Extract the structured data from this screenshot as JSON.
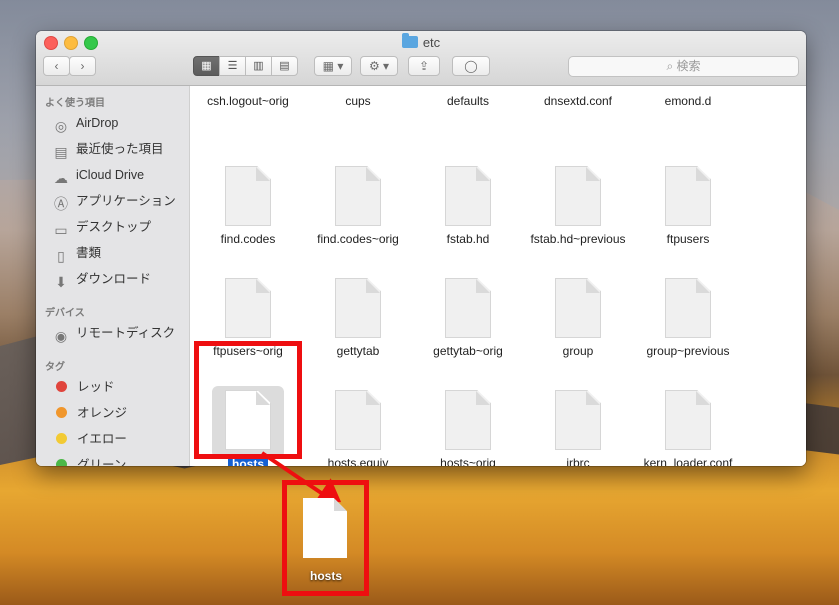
{
  "window": {
    "title": "etc",
    "search_placeholder": "検索"
  },
  "toolbar": {
    "back": "‹",
    "forward": "›",
    "views": [
      "▦",
      "☰",
      "▥",
      "▤"
    ],
    "arrange": "▦ ▾",
    "action": "⚙ ▾",
    "share": "⇪",
    "tag": "◯"
  },
  "sidebar": {
    "favorites_header": "よく使う項目",
    "favorites": [
      {
        "label": "AirDrop",
        "icon": "airdrop-icon"
      },
      {
        "label": "最近使った項目",
        "icon": "recents-icon"
      },
      {
        "label": "iCloud Drive",
        "icon": "cloud-icon"
      },
      {
        "label": "アプリケーション",
        "icon": "applications-icon"
      },
      {
        "label": "デスクトップ",
        "icon": "desktop-icon"
      },
      {
        "label": "書類",
        "icon": "documents-icon"
      },
      {
        "label": "ダウンロード",
        "icon": "downloads-icon"
      }
    ],
    "devices_header": "デバイス",
    "devices": [
      {
        "label": "リモートディスク",
        "icon": "disc-icon"
      }
    ],
    "tags_header": "タグ",
    "tags": [
      {
        "label": "レッド",
        "color": "#e0443c"
      },
      {
        "label": "オレンジ",
        "color": "#f0962c"
      },
      {
        "label": "イエロー",
        "color": "#f2ca34"
      },
      {
        "label": "グリーン",
        "color": "#4cb848"
      }
    ]
  },
  "files": {
    "row0": [
      "csh.logout~orig",
      "cups",
      "defaults",
      "dnsextd.conf",
      "emond.d"
    ],
    "row1": [
      "find.codes",
      "find.codes~orig",
      "fstab.hd",
      "fstab.hd~previous",
      "ftpusers"
    ],
    "row2": [
      "ftpusers~orig",
      "gettytab",
      "gettytab~orig",
      "group",
      "group~previous"
    ],
    "row3": [
      "hosts",
      "hosts.equiv",
      "hosts~orig",
      "irbrc",
      "kern_loader.conf"
    ]
  },
  "drag": {
    "label": "hosts"
  },
  "colors": {
    "highlight": "#ee0e10",
    "selection": "#1560d3"
  }
}
